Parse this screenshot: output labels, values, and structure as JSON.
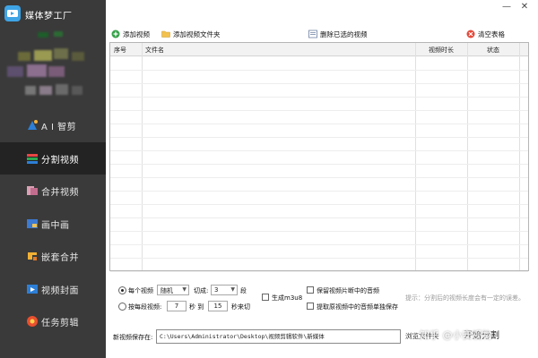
{
  "app": {
    "title": "媒体梦工厂"
  },
  "window": {
    "minimize": "—",
    "close": "✕"
  },
  "sidebar": {
    "items": [
      {
        "label": "A I 智剪",
        "icon": "ai-icon",
        "active": false
      },
      {
        "label": "分割视频",
        "icon": "split-video-icon",
        "active": true
      },
      {
        "label": "合并视频",
        "icon": "merge-video-icon",
        "active": false
      },
      {
        "label": "画中画",
        "icon": "picture-in-picture-icon",
        "active": false
      },
      {
        "label": "嵌套合并",
        "icon": "nested-merge-icon",
        "active": false
      },
      {
        "label": "视频封面",
        "icon": "video-cover-icon",
        "active": false
      },
      {
        "label": "任务剪辑",
        "icon": "task-edit-icon",
        "active": false
      }
    ]
  },
  "toolbar": {
    "add_video": "添加视频",
    "add_folder": "添加视频文件夹",
    "delete_selected": "删除已选的视频",
    "clear_table": "清空表格"
  },
  "table": {
    "columns": [
      "序号",
      "文件名",
      "视频时长",
      "状态"
    ],
    "rows": []
  },
  "options": {
    "mode_each": "每个视频",
    "random_label": "随机",
    "cut_label": "切成:",
    "cut_count": "3",
    "segments_unit": "段",
    "mode_per_segment": "按每段视频:",
    "seg_from": "7",
    "sec_to": "秒 到",
    "seg_to": "15",
    "sec_end": "秒来切",
    "gen_m3u8": "生成m3u8",
    "keep_audio": "保留视频片断中的音频",
    "extract_audio": "提取原视频中的音频单独保存",
    "hint": "提示：分割后的视频长度会有一定的误差。"
  },
  "save": {
    "label": "新视频保存在:",
    "path": "C:\\Users\\Administrator\\Desktop\\视频剪辑软件\\新媒体",
    "browse": "浏览文件夹",
    "start": "开始分割"
  },
  "watermark": "知乎 @小安视物",
  "colors": {
    "sidebar_bg": "#3a3a3a",
    "sidebar_active": "#232323",
    "accent": "#3fa4e6"
  }
}
